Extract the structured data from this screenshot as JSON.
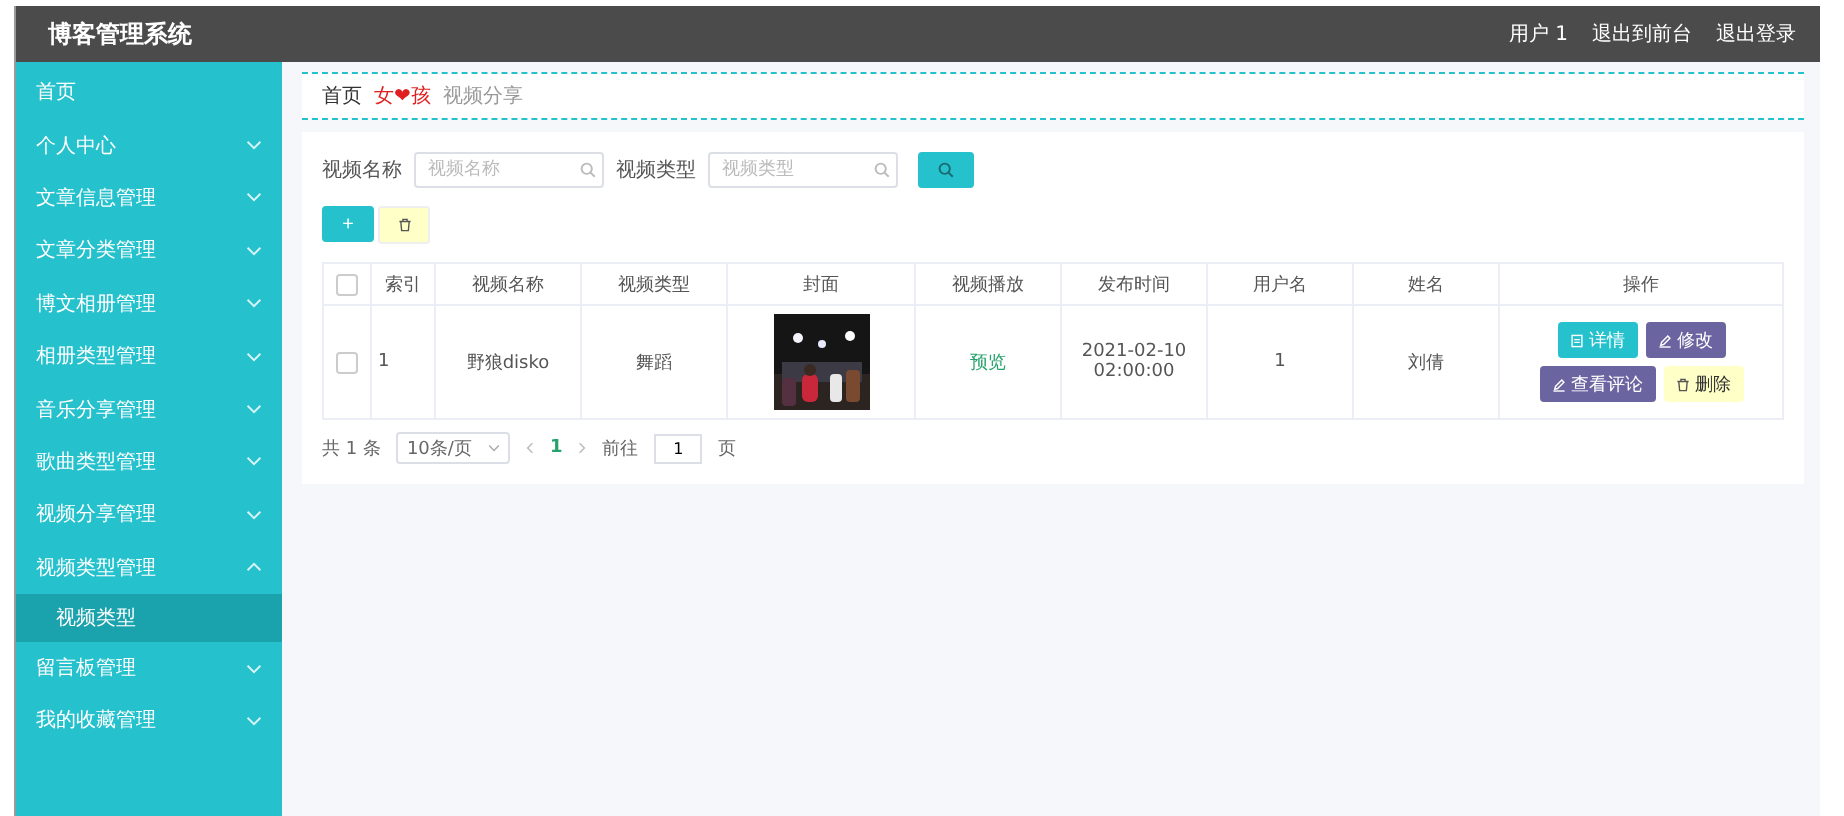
{
  "header": {
    "title": "博客管理系统",
    "links": [
      "用户 1",
      "退出到前台",
      "退出登录"
    ]
  },
  "sidebar": {
    "items": [
      {
        "label": "首页",
        "kind": "link"
      },
      {
        "label": "个人中心",
        "kind": "menu",
        "expanded": false
      },
      {
        "label": "文章信息管理",
        "kind": "menu",
        "expanded": false
      },
      {
        "label": "文章分类管理",
        "kind": "menu",
        "expanded": false
      },
      {
        "label": "博文相册管理",
        "kind": "menu",
        "expanded": false
      },
      {
        "label": "相册类型管理",
        "kind": "menu",
        "expanded": false
      },
      {
        "label": "音乐分享管理",
        "kind": "menu",
        "expanded": false
      },
      {
        "label": "歌曲类型管理",
        "kind": "menu",
        "expanded": false
      },
      {
        "label": "视频分享管理",
        "kind": "menu",
        "expanded": false
      },
      {
        "label": "视频类型管理",
        "kind": "menu",
        "expanded": true,
        "children": [
          {
            "label": "视频类型",
            "selected": true
          }
        ]
      },
      {
        "label": "留言板管理",
        "kind": "menu",
        "expanded": false
      },
      {
        "label": "我的收藏管理",
        "kind": "menu",
        "expanded": false
      }
    ]
  },
  "breadcrumb": [
    {
      "text": "首页",
      "kind": "link"
    },
    {
      "text": "女❤孩",
      "kind": "brand"
    },
    {
      "text": "视频分享",
      "kind": "current"
    }
  ],
  "search": {
    "fields": [
      {
        "label": "视频名称",
        "placeholder": "视频名称"
      },
      {
        "label": "视频类型",
        "placeholder": "视频类型"
      }
    ]
  },
  "add_button": {
    "label": "+"
  },
  "table": {
    "header_checked": false,
    "columns": [
      "索引",
      "视频名称",
      "视频类型",
      "封面",
      "视频播放",
      "发布时间",
      "用户名",
      "姓名",
      "操作"
    ],
    "rows": [
      {
        "checked": false,
        "index": "1",
        "name": "野狼disko",
        "type": "舞蹈",
        "play": "预览",
        "time": "2021-02-10 02:00:00",
        "username": "1",
        "realname": "刘倩",
        "actions": [
          {
            "kind": "detail",
            "label": "详情"
          },
          {
            "kind": "edit",
            "label": "修改"
          },
          {
            "kind": "edit",
            "label": "查看评论"
          },
          {
            "kind": "delete",
            "label": "删除"
          }
        ]
      }
    ]
  },
  "pagination": {
    "total": "共 1 条",
    "page_size": "10条/页",
    "pages": [
      {
        "label": "1",
        "selected": true
      }
    ],
    "goto_label": "前往",
    "goto_value": "1",
    "page_suffix": "页"
  }
}
